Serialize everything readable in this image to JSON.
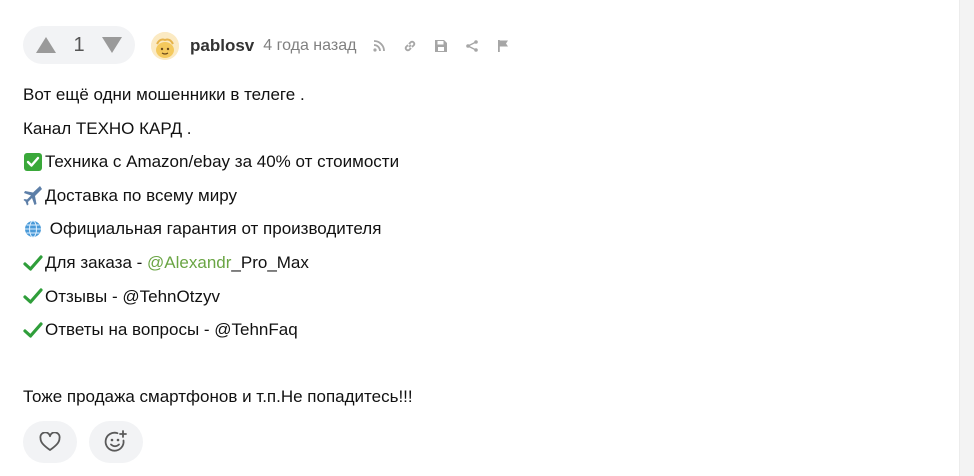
{
  "comment": {
    "rating": "1",
    "author": "pablosv",
    "time": "4 года назад",
    "lines": {
      "l1": "Вот ещё одни мошенники в телеге .",
      "l2": "Канал ТЕХНО КАРД .",
      "l3": "Техника с Amazon/ebay за 40% от стоимости",
      "l4": "Доставка по всему миру",
      "l5": " Официальная гарантия от производителя",
      "l6_prefix": "Для заказа - ",
      "l6_link": "@Alexandr",
      "l6_suffix": "_Pro_Max",
      "l7": "Отзывы - @TehnOtzyv",
      "l8": "Ответы на вопросы - @TehnFaq",
      "l9": "Тоже продажа смартфонов и т.п.Не попадитесь!!!"
    }
  },
  "icons": {
    "upvote": "triangle-up-icon",
    "downvote": "triangle-down-icon",
    "avatar": "avatar-face",
    "subscribe": "rss-icon",
    "link": "chain-link-icon",
    "save": "floppy-disk-icon",
    "share": "share-icon",
    "report": "flag-icon",
    "check_box": "check-box-emoji",
    "airplane": "airplane-emoji",
    "globe": "globe-emoji",
    "check_mark": "check-mark-emoji",
    "like": "heart-icon",
    "reaction": "emoji-add-icon"
  },
  "colors": {
    "link_green": "#6aa544",
    "check_green": "#2f9e3a",
    "control_bg": "#f2f3f5",
    "meta_gray": "#808080"
  }
}
